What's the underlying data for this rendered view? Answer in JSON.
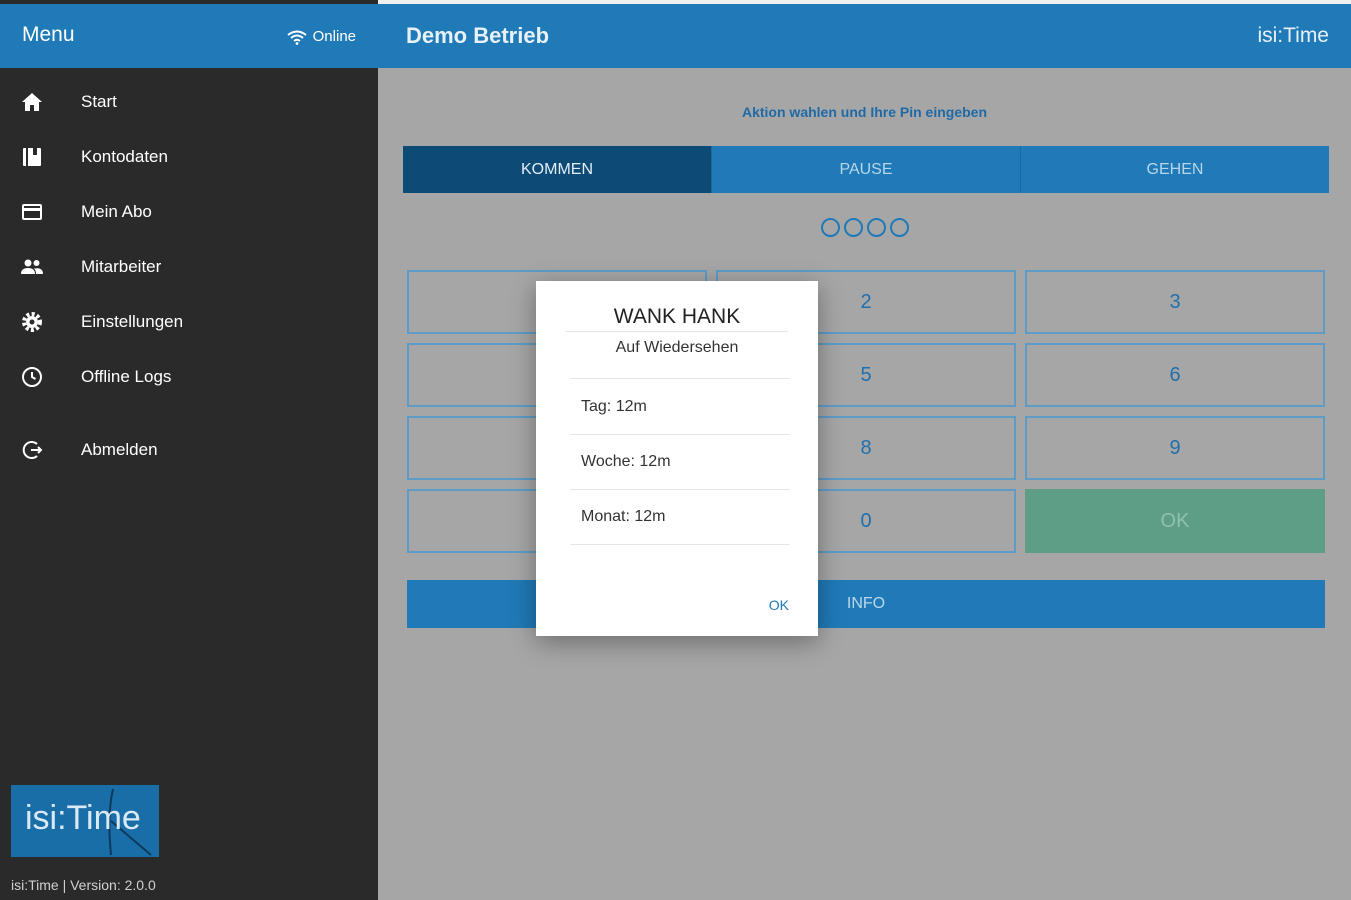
{
  "sidebar": {
    "title": "Menu",
    "status": "Online",
    "items": [
      {
        "label": "Start",
        "icon": "home-icon"
      },
      {
        "label": "Kontodaten",
        "icon": "book-icon"
      },
      {
        "label": "Mein Abo",
        "icon": "credit-card-icon"
      },
      {
        "label": "Mitarbeiter",
        "icon": "people-icon"
      },
      {
        "label": "Einstellungen",
        "icon": "gear-icon"
      },
      {
        "label": "Offline Logs",
        "icon": "clock-icon"
      },
      {
        "label": "Abmelden",
        "icon": "logout-icon"
      }
    ],
    "logo_text": "isi:Time",
    "version": "isi:Time | Version: 2.0.0"
  },
  "header": {
    "title": "Demo Betrieb",
    "brand": "isi:Time"
  },
  "main": {
    "instruction": "Aktion wahlen und Ihre Pin eingeben",
    "tabs": [
      {
        "label": "KOMMEN",
        "active": true
      },
      {
        "label": "PAUSE",
        "active": false
      },
      {
        "label": "GEHEN",
        "active": false
      }
    ],
    "pin_length": 4,
    "keys": {
      "k1": "",
      "k2": "2",
      "k3": "3",
      "k4": "",
      "k5": "5",
      "k6": "6",
      "k7": "",
      "k8": "8",
      "k9": "9",
      "k_left": "",
      "k0": "0",
      "ok": "OK"
    },
    "info_button": "INFO"
  },
  "dialog": {
    "name": "WANK HANK",
    "subtitle": "Auf Wiedersehen",
    "day": "Tag: 12m",
    "week": "Woche: 12m",
    "month": "Monat: 12m",
    "ok": "OK"
  },
  "colors": {
    "primary": "#1f7ab7",
    "active_tab": "#0d4a76",
    "sidebar_bg": "#2a2a2a",
    "overlay_bg": "#a6a6a6",
    "ok_key": "#5e9e86"
  }
}
